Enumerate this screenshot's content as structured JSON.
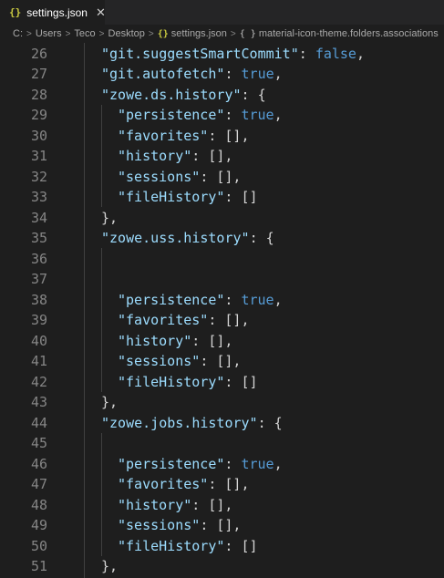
{
  "tab": {
    "icon": "{}",
    "title": "settings.json",
    "close": "✕"
  },
  "breadcrumb": [
    "C:",
    "Users",
    "Teco",
    "Desktop",
    "settings.json",
    "material-icon-theme.folders.associations"
  ],
  "breadcrumb_icons": {
    "json": "{}",
    "object": "{ }"
  },
  "lines": [
    {
      "n": "26",
      "indent": 1,
      "tokens": [
        [
          "key",
          "\"git.suggestSmartCommit\""
        ],
        [
          "punct",
          ": "
        ],
        [
          "kw",
          "false"
        ],
        [
          "punct",
          ","
        ]
      ]
    },
    {
      "n": "27",
      "indent": 1,
      "tokens": [
        [
          "key",
          "\"git.autofetch\""
        ],
        [
          "punct",
          ": "
        ],
        [
          "kw",
          "true"
        ],
        [
          "punct",
          ","
        ]
      ]
    },
    {
      "n": "28",
      "indent": 1,
      "tokens": [
        [
          "key",
          "\"zowe.ds.history\""
        ],
        [
          "punct",
          ": {"
        ]
      ]
    },
    {
      "n": "29",
      "indent": 2,
      "tokens": [
        [
          "key",
          "\"persistence\""
        ],
        [
          "punct",
          ": "
        ],
        [
          "kw",
          "true"
        ],
        [
          "punct",
          ","
        ]
      ]
    },
    {
      "n": "30",
      "indent": 2,
      "tokens": [
        [
          "key",
          "\"favorites\""
        ],
        [
          "punct",
          ": [],"
        ]
      ]
    },
    {
      "n": "31",
      "indent": 2,
      "tokens": [
        [
          "key",
          "\"history\""
        ],
        [
          "punct",
          ": [],"
        ]
      ]
    },
    {
      "n": "32",
      "indent": 2,
      "tokens": [
        [
          "key",
          "\"sessions\""
        ],
        [
          "punct",
          ": [],"
        ]
      ]
    },
    {
      "n": "33",
      "indent": 2,
      "tokens": [
        [
          "key",
          "\"fileHistory\""
        ],
        [
          "punct",
          ": []"
        ]
      ]
    },
    {
      "n": "34",
      "indent": 1,
      "tokens": [
        [
          "punct",
          "},"
        ]
      ]
    },
    {
      "n": "35",
      "indent": 1,
      "tokens": [
        [
          "key",
          "\"zowe.uss.history\""
        ],
        [
          "punct",
          ": {"
        ]
      ]
    },
    {
      "n": "36",
      "indent": 2,
      "tokens": []
    },
    {
      "n": "37",
      "indent": 2,
      "tokens": []
    },
    {
      "n": "38",
      "indent": 2,
      "tokens": [
        [
          "key",
          "\"persistence\""
        ],
        [
          "punct",
          ": "
        ],
        [
          "kw",
          "true"
        ],
        [
          "punct",
          ","
        ]
      ]
    },
    {
      "n": "39",
      "indent": 2,
      "tokens": [
        [
          "key",
          "\"favorites\""
        ],
        [
          "punct",
          ": [],"
        ]
      ]
    },
    {
      "n": "40",
      "indent": 2,
      "tokens": [
        [
          "key",
          "\"history\""
        ],
        [
          "punct",
          ": [],"
        ]
      ]
    },
    {
      "n": "41",
      "indent": 2,
      "tokens": [
        [
          "key",
          "\"sessions\""
        ],
        [
          "punct",
          ": [],"
        ]
      ]
    },
    {
      "n": "42",
      "indent": 2,
      "tokens": [
        [
          "key",
          "\"fileHistory\""
        ],
        [
          "punct",
          ": []"
        ]
      ]
    },
    {
      "n": "43",
      "indent": 1,
      "tokens": [
        [
          "punct",
          "},"
        ]
      ]
    },
    {
      "n": "44",
      "indent": 1,
      "tokens": [
        [
          "key",
          "\"zowe.jobs.history\""
        ],
        [
          "punct",
          ": {"
        ]
      ]
    },
    {
      "n": "45",
      "indent": 2,
      "tokens": []
    },
    {
      "n": "46",
      "indent": 2,
      "tokens": [
        [
          "key",
          "\"persistence\""
        ],
        [
          "punct",
          ": "
        ],
        [
          "kw",
          "true"
        ],
        [
          "punct",
          ","
        ]
      ]
    },
    {
      "n": "47",
      "indent": 2,
      "tokens": [
        [
          "key",
          "\"favorites\""
        ],
        [
          "punct",
          ": [],"
        ]
      ]
    },
    {
      "n": "48",
      "indent": 2,
      "tokens": [
        [
          "key",
          "\"history\""
        ],
        [
          "punct",
          ": [],"
        ]
      ]
    },
    {
      "n": "49",
      "indent": 2,
      "tokens": [
        [
          "key",
          "\"sessions\""
        ],
        [
          "punct",
          ": [],"
        ]
      ]
    },
    {
      "n": "50",
      "indent": 2,
      "tokens": [
        [
          "key",
          "\"fileHistory\""
        ],
        [
          "punct",
          ": []"
        ]
      ]
    },
    {
      "n": "51",
      "indent": 1,
      "tokens": [
        [
          "punct",
          "},"
        ]
      ]
    }
  ]
}
